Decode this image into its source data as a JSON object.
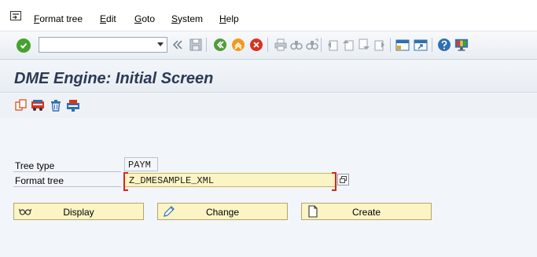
{
  "menubar": {
    "system_menu_icon": "system-menu-icon",
    "items": [
      {
        "label": "Format tree",
        "mnemonic": "F"
      },
      {
        "label": "Edit",
        "mnemonic": "E"
      },
      {
        "label": "Goto",
        "mnemonic": "G"
      },
      {
        "label": "System",
        "mnemonic": "S"
      },
      {
        "label": "Help",
        "mnemonic": "H"
      }
    ]
  },
  "toolbar": {
    "command_field": {
      "value": "",
      "placeholder": ""
    },
    "icons": [
      "enter-icon",
      "collapse-icon",
      "save-icon",
      "back-icon",
      "exit-icon",
      "cancel-icon",
      "print-icon",
      "find-icon",
      "find-next-icon",
      "first-page-icon",
      "previous-page-icon",
      "next-page-icon",
      "last-page-icon",
      "create-session-icon",
      "shortcut-icon",
      "help-icon",
      "customize-layout-icon"
    ]
  },
  "title": "DME Engine: Initial Screen",
  "app_toolbar": {
    "icons": [
      "copy-icon",
      "transport-icon",
      "delete-icon",
      "import-icon"
    ]
  },
  "form": {
    "tree_type": {
      "label": "Tree type",
      "value": "PAYM"
    },
    "format_tree": {
      "label": "Format tree",
      "value": "Z_DMESAMPLE_XML"
    }
  },
  "buttons": {
    "display": "Display",
    "change": "Change",
    "create": "Create"
  },
  "colors": {
    "required_field_bg": "#fbf4c4",
    "required_marker": "#d8261c",
    "title_text": "#2b3a55",
    "ok_green": "#46a12f"
  }
}
